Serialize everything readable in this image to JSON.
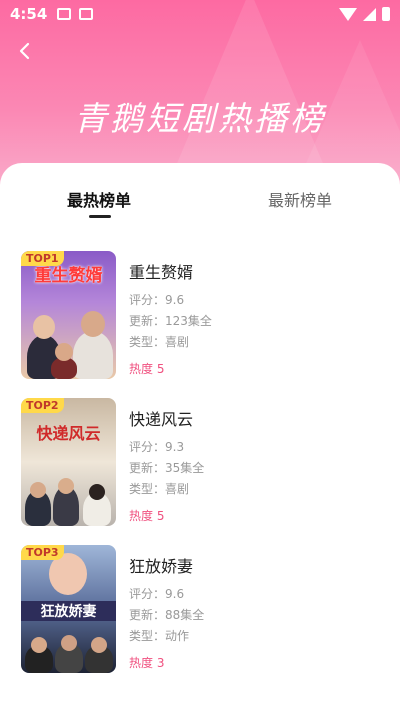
{
  "status_bar": {
    "time": "4:54"
  },
  "header": {
    "back_icon": "chevron-left-icon",
    "title": "青鹅短剧热播榜"
  },
  "tabs": [
    {
      "label": "最热榜单",
      "active": true
    },
    {
      "label": "最新榜单",
      "active": false
    }
  ],
  "colors": {
    "accent": "#f0507f",
    "badge": "#ffd94a",
    "hero": "#fd6aa2"
  },
  "items": [
    {
      "rank": "TOP1",
      "cover_title": "重生赘婿",
      "name": "重生赘婿",
      "score": "评分：9.6",
      "update": "更新：123集全",
      "type": "类型：喜剧",
      "heat": "热度 5"
    },
    {
      "rank": "TOP2",
      "cover_title": "快递风云",
      "name": "快递风云",
      "score": "评分：9.3",
      "update": "更新：35集全",
      "type": "类型：喜剧",
      "heat": "热度 5"
    },
    {
      "rank": "TOP3",
      "cover_title": "狂放娇妻",
      "name": "狂放娇妻",
      "score": "评分：9.6",
      "update": "更新：88集全",
      "type": "类型：动作",
      "heat": "热度 3"
    }
  ]
}
